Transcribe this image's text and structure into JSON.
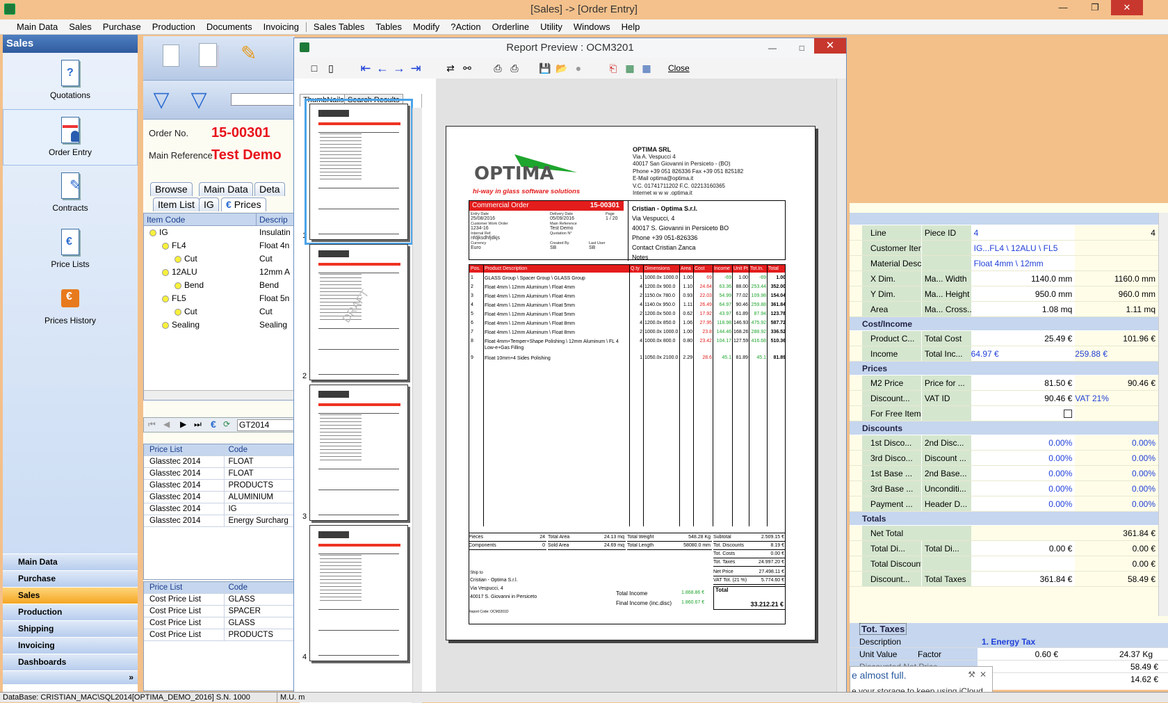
{
  "window": {
    "title": "[Sales] -> [Order Entry]"
  },
  "menu": [
    "Main Data",
    "Sales",
    "Purchase",
    "Production",
    "Documents",
    "Invoicing",
    "Sales Tables",
    "Tables",
    "Modify",
    "?Action",
    "Orderline",
    "Utility",
    "Windows",
    "Help"
  ],
  "nav": {
    "header": "Sales",
    "items": [
      "Quotations",
      "Order Entry",
      "Contracts",
      "Price Lists",
      "Prices History"
    ],
    "groups": [
      "Main Data",
      "Purchase",
      "Sales",
      "Production",
      "Shipping",
      "Invoicing",
      "Dashboards"
    ]
  },
  "order": {
    "no_label": "Order No.",
    "no": "15-00301",
    "ref_label": "Main Reference",
    "ref": "Test Demo",
    "tabs1": [
      "Browse",
      "Main Data",
      "Deta"
    ],
    "tabs2": [
      "Item List",
      "IG",
      "Prices"
    ],
    "tab_euro": "€"
  },
  "tree": {
    "col1": "Item Code",
    "col2": "Descrip",
    "rows": [
      [
        "IG",
        "Insulatin"
      ],
      [
        "FL4",
        "Float 4n"
      ],
      [
        "Cut",
        "Cut"
      ],
      [
        "12ALU",
        "12mm A"
      ],
      [
        "Bend",
        "Bend"
      ],
      [
        "FL5",
        "Float 5n"
      ],
      [
        "Cut",
        "Cut"
      ],
      [
        "Sealing",
        "Sealing"
      ]
    ]
  },
  "plist_nav": {
    "value": "GT2014",
    "euro": "€"
  },
  "plist1": {
    "h1": "Price List",
    "h2": "Code",
    "rows": [
      [
        "Glasstec 2014",
        "FLOAT"
      ],
      [
        "Glasstec 2014",
        "FLOAT"
      ],
      [
        "Glasstec 2014",
        "PRODUCTS"
      ],
      [
        "Glasstec 2014",
        "ALUMINIUM"
      ],
      [
        "Glasstec 2014",
        "IG"
      ],
      [
        "Glasstec 2014",
        "Energy Surcharg"
      ]
    ]
  },
  "plist2": {
    "h1": "Price List",
    "h2": "Code",
    "rows": [
      [
        "Cost Price List",
        "GLASS"
      ],
      [
        "Cost Price List",
        "SPACER"
      ],
      [
        "Cost Price List",
        "GLASS"
      ],
      [
        "Cost Price List",
        "PRODUCTS"
      ]
    ]
  },
  "preview": {
    "title": "Report Preview : OCM3201",
    "close": "Close",
    "tab1": "ThumbNails",
    "tab2": "Search Results",
    "thumbs": [
      "1",
      "2",
      "3",
      "4"
    ],
    "draft": "DRAFT"
  },
  "doc": {
    "logo": "OPTIMA",
    "tagline": "hi-way in glass software solutions",
    "company": [
      "OPTIMA SRL",
      "Via A. Vespucci 4",
      "40017 San Giovanni in Persiceto - (BO)",
      "Phone  +39 051 826336     Fax     +39 051 825182",
      "E-Mail  optima@optima.it",
      "V.C.    01741711202          F.C.     02213160365",
      "Internet  w w w .optima.it"
    ],
    "co_title": "Commercial Order",
    "co_no": "15-00301",
    "meta": [
      [
        "Entry Date",
        "25/08/2016"
      ],
      [
        "Delivery Date",
        "05/09/2016"
      ],
      [
        "Page",
        "1 / 20"
      ],
      [
        "Customer Work Order",
        "1234-16"
      ],
      [
        "Main Reference",
        "Test Demo"
      ],
      [
        "Internal Ref.",
        "nfdjksdhfjdkjs"
      ],
      [
        "Quotation N°",
        ""
      ],
      [
        "Currency",
        "Euro"
      ],
      [
        "Created By",
        "SB"
      ],
      [
        "Last User",
        "SB"
      ]
    ],
    "customer": [
      "Cristian - Optima S.r.l.",
      "Via Vespucci, 4",
      "40017 S. Giovanni in Persiceto BO",
      "Phone  +39 051-826336",
      "Contact   Cristian Zanca",
      "Notes"
    ],
    "cols": [
      "Pos.",
      "Product Description",
      "Q.ty",
      "Dimensions",
      "Area",
      "Cost",
      "Income",
      "Unit Pr.",
      "Tot.In.",
      "Total"
    ],
    "rows": [
      [
        "1",
        "GLASS Group \\ Spacer Group \\ GLASS Group",
        "1",
        "1000.0x 1000.0",
        "1.00",
        "69",
        "-69",
        "1.00",
        "-69",
        "1.00"
      ],
      [
        "2",
        "Float 4mm \\ 12mm Aluminum \\ Float 4mm",
        "4",
        "1200.0x 900.0",
        "1.10",
        "24.64",
        "63.36",
        "88.00",
        "253.44",
        "352.00"
      ],
      [
        "3",
        "Float 4mm \\ 12mm Aluminum \\ Float 4mm",
        "2",
        "1150.0x 780.0",
        "0.93",
        "22.03",
        "54.99",
        "77.02",
        "109.98",
        "154.04"
      ],
      [
        "4",
        "Float 4mm \\ 12mm Aluminum \\ Float 5mm",
        "4",
        "1140.0x 950.0",
        "1.11",
        "26.49",
        "64.97",
        "90.46",
        "259.88",
        "361.84"
      ],
      [
        "5",
        "Float 4mm \\ 12mm Aluminum \\ Float 5mm",
        "2",
        "1200.0x 500.0",
        "0.62",
        "17.92",
        "43.97",
        "61.89",
        "87.94",
        "123.78"
      ],
      [
        "6",
        "Float 4mm \\ 12mm Aluminum \\ Float 8mm",
        "4",
        "1200.0x 850.0",
        "1.06",
        "27.95",
        "118.98",
        "146.93",
        "475.92",
        "587.72"
      ],
      [
        "7",
        "Float 4mm \\ 12mm Aluminum \\ Float 8mm",
        "2",
        "1000.0x 1000.0",
        "1.00",
        "23.8",
        "144.46",
        "168.26",
        "288.92",
        "336.52"
      ],
      [
        "8",
        "Float 4mm+Temper+Shape Polishing \\ 12mm Aluminum \\ FL 4 Low-e+Gas Filling",
        "4",
        "1000.0x 800.0",
        "0.80",
        "23.42",
        "104.17",
        "127.59",
        "416.68",
        "510.36"
      ],
      [
        "9",
        "Float 10mm+4 Sides Polishing",
        "1",
        "1050.0x 2100.0",
        "2.29",
        "28.6",
        "45.1",
        "81.89",
        "45.1",
        "81.89"
      ]
    ],
    "footer": {
      "pieces": "Pieces",
      "pieces_v": "24",
      "area": "Total Area",
      "area_v": "24.13 mq",
      "weight": "Total Weight",
      "weight_v": "548.28 Kg",
      "components": "Components",
      "components_v": "0",
      "sold": "Sold Area",
      "sold_v": "24.69 mq",
      "length": "Total Length",
      "length_v": "58080.0 mm",
      "subtotal": "Subtotal",
      "subtotal_v": "2.509.15 €",
      "tdisc": "Tot. Discounts",
      "tdisc_v": "8.19 €",
      "tcosts": "Tot. Costs",
      "tcosts_v": "0.00 €",
      "ttaxes": "Tot. Taxes",
      "ttaxes_v": "24.997.20 €",
      "net": "Net Price",
      "net_v": "27.498.11 €",
      "vat": "VAT Tot. (21 %)",
      "vat_v": "5.774.60 €",
      "total": "Total",
      "total_v": "33.212.21 €",
      "shipto": "Ship to",
      "ship": [
        "Cristian - Optima S.r.l.",
        "Via Vespucci, 4",
        "40017 S. Giovanni in Persiceto"
      ],
      "ti": "Total Income",
      "ti_v": "1.868.86 €",
      "fi": "Final Income (inc.disc)",
      "fi_v": "1.860.67 €",
      "rc": "Report Code:   OCM3201D"
    }
  },
  "props": {
    "top": [
      [
        "Line",
        "Piece ID",
        "4",
        "4"
      ],
      [
        "Customer Item",
        "",
        "IG...FL4 \\ 12ALU \\ FL5",
        ""
      ],
      [
        "Material Descr.",
        "",
        "Float 4mm \\ 12mm Aluminum \\ Float 5mm",
        ""
      ],
      [
        "X Dim.",
        "Ma...  Width",
        "1140.0 mm",
        "1160.0 mm"
      ],
      [
        "Y Dim.",
        "Ma...  Height",
        "950.0 mm",
        "960.0 mm"
      ],
      [
        "Area",
        "Ma...  Cross...",
        "1.08 mq",
        "1.11 mq"
      ]
    ],
    "s_cost": "Cost/Income",
    "cost": [
      [
        "Product C...",
        "Total Cost",
        "25.49 €",
        "101.96 €"
      ],
      [
        "Income",
        "Total Inc...",
        "64.97 €",
        "259.88 €"
      ]
    ],
    "s_prices": "Prices",
    "prices": [
      [
        "M2 Price",
        "Price for ...",
        "81.50 €",
        "90.46 €"
      ],
      [
        "Discount...",
        "VAT ID",
        "90.46 €",
        "VAT 21%"
      ],
      [
        "For Free Item",
        "",
        "",
        ""
      ]
    ],
    "s_disc": "Discounts",
    "disc": [
      [
        "1st Disco...",
        "2nd Disc...",
        "0.00%",
        "0.00%"
      ],
      [
        "3rd Disco...",
        "Discount ...",
        "0.00%",
        "0.00%"
      ],
      [
        "1st Base ...",
        "2nd Base...",
        "0.00%",
        "0.00%"
      ],
      [
        "3rd Base ...",
        "Unconditi...",
        "0.00%",
        "0.00%"
      ],
      [
        "Payment ...",
        "Header D...",
        "0.00%",
        "0.00%"
      ]
    ],
    "s_tot": "Totals",
    "net_total": "Net Total",
    "net_total_v": "361.84 €",
    "tot": [
      [
        "Total Di...",
        "Total Di...",
        "0.00 €",
        "0.00 €"
      ],
      [
        "Total Discount",
        "",
        "",
        "0.00 €"
      ],
      [
        "Discount...",
        "Total Taxes",
        "361.84 €",
        "58.49 €"
      ]
    ],
    "taxes_title": "Tot. Taxes",
    "tax_desc_l": "Description",
    "tax_desc_v": "1. Energy Tax",
    "tax_unit_l": "Unit Value",
    "tax_factor_l": "Factor",
    "tax_unit_v": "0.60 €",
    "tax_factor_v": "24.37 Kg",
    "disc_net_l": "Discounted Net Price",
    "disc_net_v": "58.49 €",
    "last_v": "14.62 €"
  },
  "toast": {
    "line1": "e almost full.",
    "line2": "e your storage to keep using iCloud."
  },
  "status": {
    "db": "DataBase: CRISTIAN_MAC\\SQL2014[OPTIMA_DEMO_2016] S.N. 1000",
    "mu": "M.U. m"
  }
}
